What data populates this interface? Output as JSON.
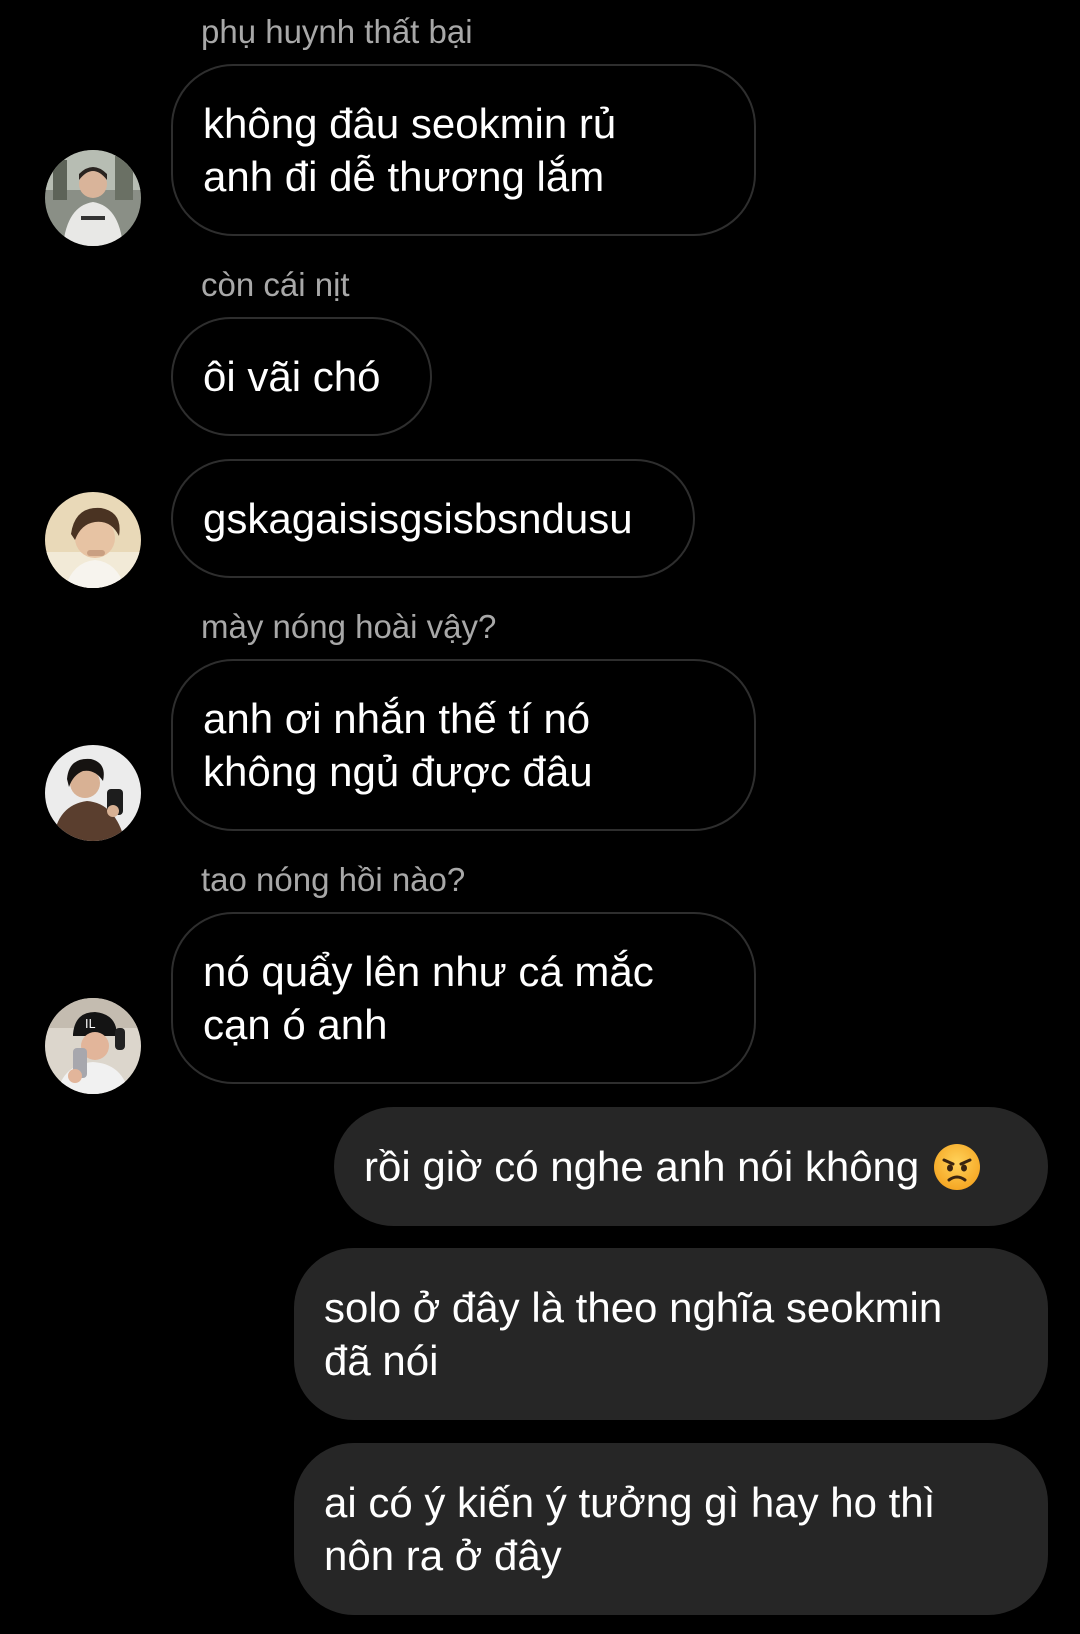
{
  "messages": [
    {
      "sender": "phụ huynh thất bại",
      "text": "không đâu seokmin rủ\nanh đi dễ thương lắm"
    },
    {
      "sender": "còn cái nịt",
      "text": "ôi vãi chó"
    },
    {
      "text": "gskagaisisgsisbsndusu"
    },
    {
      "sender": "mày nóng hoài vậy?",
      "text": "anh ơi nhắn thế tí nó\nkhông ngủ được đâu"
    },
    {
      "sender": "tao nóng hồi nào?",
      "text": "nó quẩy lên như cá mắc\ncạn ó anh"
    }
  ],
  "outgoing": [
    {
      "text": "rồi giờ có nghe anh nói không",
      "emoji": "angry-face-icon"
    },
    {
      "text": "solo ở đây là theo nghĩa seokmin\nđã nói"
    },
    {
      "text": "ai có ý kiến ý tưởng gì hay ho thì\nnôn ra ở đây"
    }
  ],
  "colors": {
    "background": "#000000",
    "incoming_border": "#2e2e2e",
    "outgoing_bubble": "#262626",
    "sender_name": "#a8a8a8",
    "text": "#ffffff"
  }
}
